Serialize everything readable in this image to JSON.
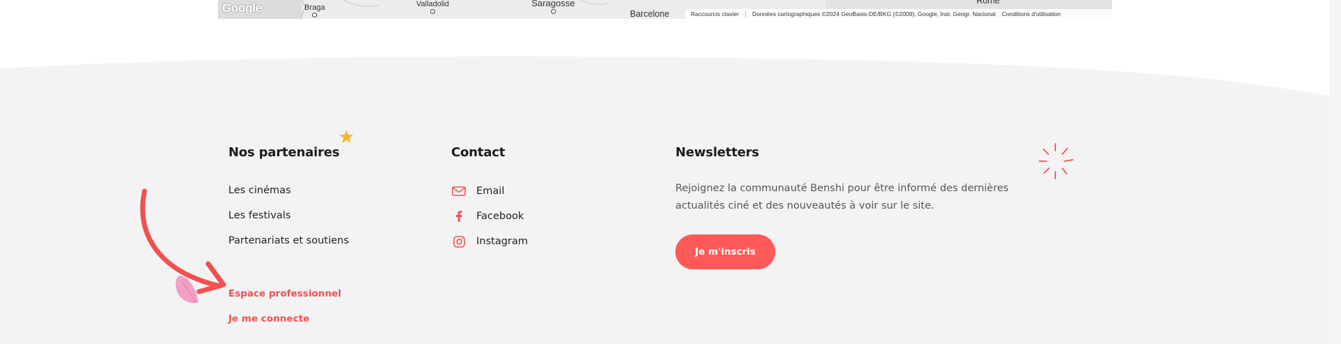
{
  "map": {
    "logo": "Google",
    "cities": [
      {
        "name": "Braga"
      },
      {
        "name": "Valladolid"
      },
      {
        "name": "Saragosse"
      },
      {
        "name": "Barcelone"
      },
      {
        "name": "Rome"
      }
    ],
    "attribution": {
      "shortcuts": "Raccourcis clavier",
      "data": "Données cartographiques ©2024 GeoBasis-DE/BKG (©2009), Google, Inst. Geogr. Nacional",
      "terms": "Conditions d'utilisation"
    }
  },
  "footer": {
    "partners": {
      "title": "Nos partenaires",
      "links": [
        "Les cinémas",
        "Les festivals",
        "Partenariats et soutiens"
      ],
      "pro_links": [
        "Espace professionnel",
        "Je me connecte"
      ]
    },
    "contact": {
      "title": "Contact",
      "items": [
        {
          "label": "Email",
          "icon": "mail-icon"
        },
        {
          "label": "Facebook",
          "icon": "facebook-icon"
        },
        {
          "label": "Instagram",
          "icon": "instagram-icon"
        }
      ]
    },
    "newsletters": {
      "title": "Newsletters",
      "description": "Rejoignez la communauté Benshi pour être informé des dernières actualités ciné et des nouveautés à voir sur le site.",
      "button": "Je m'inscris"
    }
  },
  "colors": {
    "accent": "#ff5a57",
    "footer_bg": "#f3f3f3",
    "star": "#f5b731",
    "petal": "#f2a0c4"
  }
}
